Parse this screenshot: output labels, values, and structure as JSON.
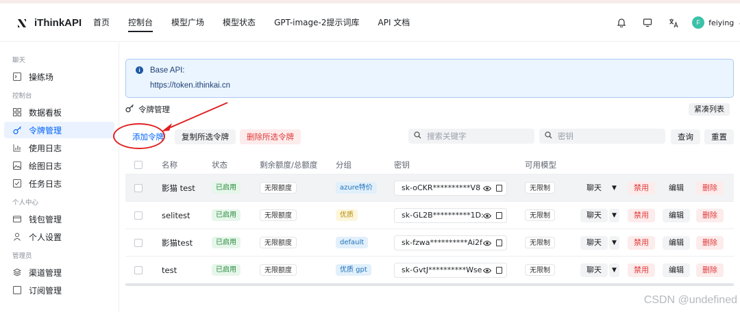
{
  "header": {
    "brand": "iThinkAPI",
    "nav": [
      "首页",
      "控制台",
      "模型广场",
      "模型状态",
      "GPT-image-2提示词库",
      "API 文档"
    ],
    "active_nav": "控制台",
    "user": {
      "initial": "F",
      "name": "feiying"
    }
  },
  "sidebar": {
    "sections": [
      {
        "title": "聊天",
        "items": [
          {
            "label": "操练场",
            "icon": "terminal-icon"
          }
        ]
      },
      {
        "title": "控制台",
        "items": [
          {
            "label": "数据看板",
            "icon": "grid-icon"
          },
          {
            "label": "令牌管理",
            "icon": "key-icon",
            "active": true
          },
          {
            "label": "使用日志",
            "icon": "bar-chart-icon"
          },
          {
            "label": "绘图日志",
            "icon": "image-icon"
          },
          {
            "label": "任务日志",
            "icon": "checklist-icon"
          }
        ]
      },
      {
        "title": "个人中心",
        "items": [
          {
            "label": "钱包管理",
            "icon": "wallet-icon"
          },
          {
            "label": "个人设置",
            "icon": "user-icon"
          }
        ]
      },
      {
        "title": "管理员",
        "items": [
          {
            "label": "渠道管理",
            "icon": "layers-icon"
          },
          {
            "label": "订阅管理",
            "icon": "subscription-icon"
          }
        ]
      }
    ]
  },
  "banner": {
    "title": "Base API:",
    "url": "https://token.ithinkai.cn"
  },
  "page": {
    "title": "令牌管理",
    "compact_label": "紧凑列表"
  },
  "toolbar": {
    "add_label": "添加令牌",
    "copy_label": "复制所选令牌",
    "delete_label": "删除所选令牌",
    "keyword_placeholder": "搜索关键字",
    "key_placeholder": "密钥",
    "query_label": "查询",
    "reset_label": "重置"
  },
  "table": {
    "columns": [
      "名称",
      "状态",
      "剩余额度/总额度",
      "分组",
      "密钥",
      "可用模型"
    ],
    "rows": [
      {
        "name": "影猫 test",
        "status": "已启用",
        "quota": "无限额度",
        "group": "azure特价",
        "group_color": "blue",
        "key": "sk-oCKR**********V8",
        "models": "无限制"
      },
      {
        "name": "selitest",
        "status": "已启用",
        "quota": "无限额度",
        "group": "优质",
        "group_color": "yellow",
        "key": "sk-GL2B**********1D:",
        "models": "无限制"
      },
      {
        "name": "影猫test",
        "status": "已启用",
        "quota": "无限额度",
        "group": "default",
        "group_color": "blue",
        "key": "sk-fzwa**********Ai2f",
        "models": "无限制"
      },
      {
        "name": "test",
        "status": "已启用",
        "quota": "无限额度",
        "group": "优质 gpt",
        "group_color": "blue",
        "key": "sk-GvtJ**********Wse",
        "models": "无限制"
      }
    ],
    "actions": {
      "chat": "聊天",
      "disable": "禁用",
      "edit": "编辑",
      "delete": "删除"
    }
  },
  "watermark": "CSDN @undefined",
  "colors": {
    "primary": "#0064fa",
    "danger": "#e03a3a",
    "annotation": "#e02020"
  }
}
